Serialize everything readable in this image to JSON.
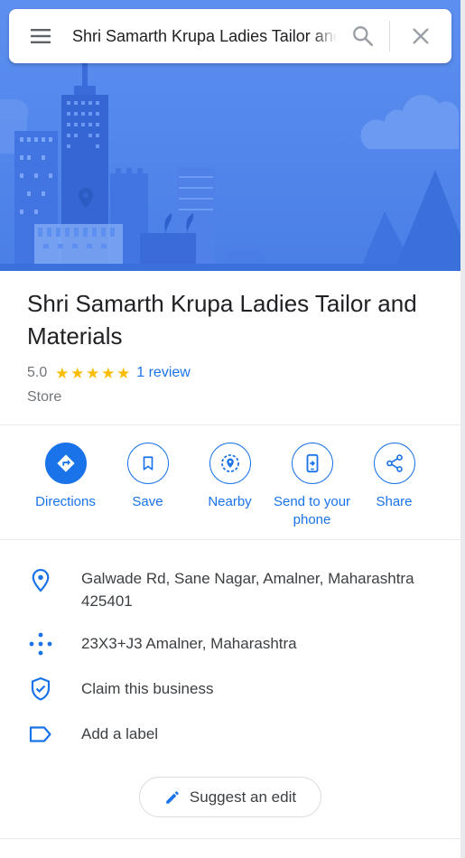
{
  "search": {
    "query": "Shri Samarth Krupa Ladies Tailor and Materials"
  },
  "place": {
    "title": "Shri Samarth Krupa Ladies Tailor and Materials",
    "rating": "5.0",
    "stars": 5,
    "reviews": "1 review",
    "category": "Store"
  },
  "actions": [
    {
      "label": "Directions",
      "icon": "directions-icon"
    },
    {
      "label": "Save",
      "icon": "bookmark-icon"
    },
    {
      "label": "Nearby",
      "icon": "nearby-icon"
    },
    {
      "label": "Send to your phone",
      "icon": "send-to-phone-icon"
    },
    {
      "label": "Share",
      "icon": "share-icon"
    }
  ],
  "info": {
    "address": "Galwade Rd, Sane Nagar, Amalner, Maharashtra 425401",
    "plus_code": "23X3+J3 Amalner, Maharashtra",
    "claim": "Claim this business",
    "label": "Add a label"
  },
  "suggest_edit": "Suggest an edit",
  "colors": {
    "accent": "#1a73e8",
    "star": "#fbbc04",
    "hero_sky": "#5b8def"
  }
}
